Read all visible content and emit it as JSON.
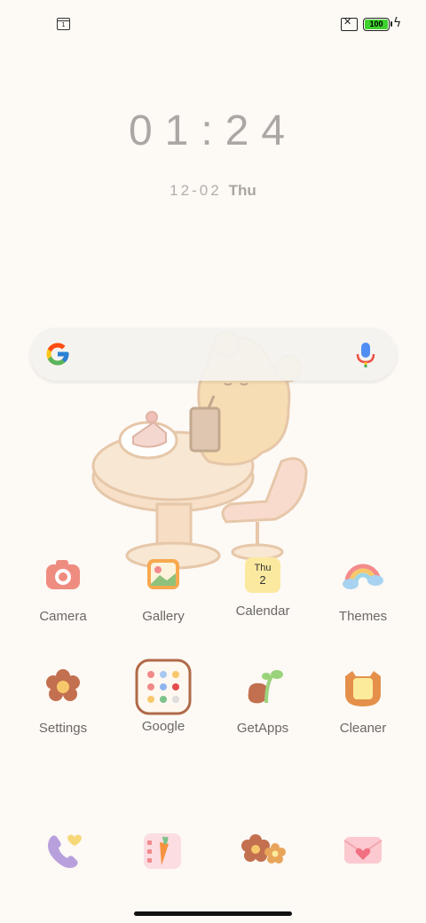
{
  "status_bar": {
    "left_icon": "calendar-notification-icon",
    "left_icon_text": "1",
    "sim_icon": "no-sim-icon",
    "battery_level": "100",
    "charging_icon": "charging-bolt-icon"
  },
  "lockscreen_widget": {
    "time": "01:24",
    "date": "12-02",
    "weekday": "Thu"
  },
  "search_bar": {
    "logo": "google-g-icon",
    "mic_icon": "microphone-icon"
  },
  "apps_row1": [
    {
      "label": "Camera",
      "icon": "camera-icon"
    },
    {
      "label": "Gallery",
      "icon": "gallery-icon"
    },
    {
      "label": "Calendar",
      "icon": "calendar-icon",
      "cal_day": "Thu",
      "cal_date": "2"
    },
    {
      "label": "Themes",
      "icon": "rainbow-icon"
    }
  ],
  "apps_row2": [
    {
      "label": "Settings",
      "icon": "flower-gear-icon"
    },
    {
      "label": "Google",
      "icon": "google-folder-icon"
    },
    {
      "label": "GetApps",
      "icon": "sprout-icon"
    },
    {
      "label": "Cleaner",
      "icon": "trash-cat-icon"
    }
  ],
  "dock": [
    {
      "icon": "phone-icon"
    },
    {
      "icon": "messages-carrot-icon"
    },
    {
      "icon": "flowers-icon"
    },
    {
      "icon": "envelope-heart-icon"
    }
  ],
  "colors": {
    "background": "#fdf9f5",
    "clock_text": "#aaa7a4",
    "label_text": "#6b6865",
    "battery_fill": "#3fd12d"
  }
}
